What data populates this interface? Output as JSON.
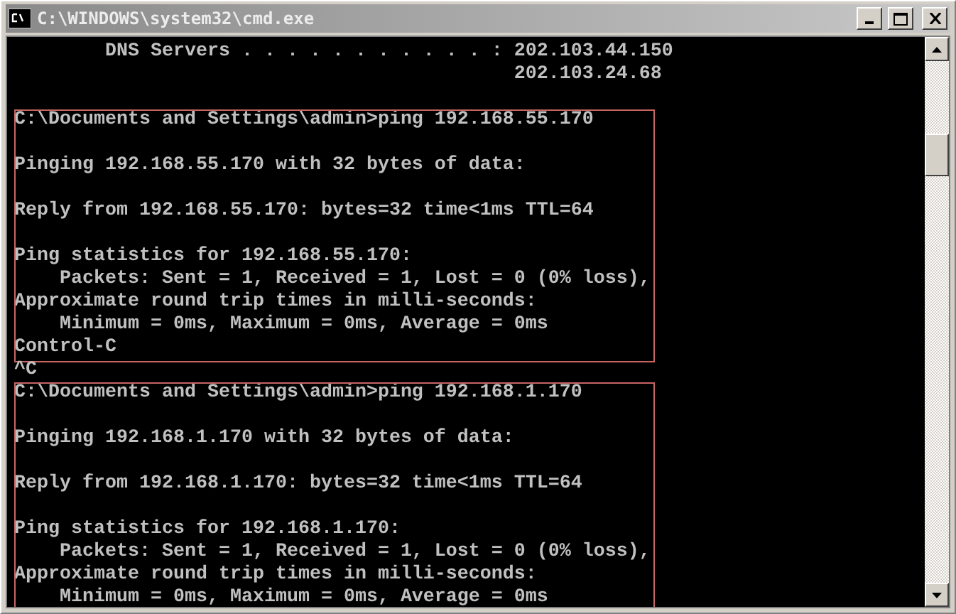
{
  "window": {
    "title": "C:\\WINDOWS\\system32\\cmd.exe"
  },
  "sections": [
    {
      "highlighted": false,
      "lines": [
        {
          "kind": "text",
          "text": "        DNS Servers . . . . . . . . . . . : 202.103.44.150"
        },
        {
          "kind": "text",
          "text": "                                            202.103.24.68"
        },
        {
          "kind": "blank"
        }
      ]
    },
    {
      "highlighted": true,
      "lines": [
        {
          "kind": "text",
          "text": "C:\\Documents and Settings\\admin>ping 192.168.55.170"
        },
        {
          "kind": "blank"
        },
        {
          "kind": "text",
          "text": "Pinging 192.168.55.170 with 32 bytes of data:"
        },
        {
          "kind": "blank"
        },
        {
          "kind": "text",
          "text": "Reply from 192.168.55.170: bytes=32 time<1ms TTL=64"
        },
        {
          "kind": "blank"
        },
        {
          "kind": "text",
          "text": "Ping statistics for 192.168.55.170:"
        },
        {
          "kind": "text",
          "text": "    Packets: Sent = 1, Received = 1, Lost = 0 (0% loss),"
        },
        {
          "kind": "text",
          "text": "Approximate round trip times in milli-seconds:"
        },
        {
          "kind": "text",
          "text": "    Minimum = 0ms, Maximum = 0ms, Average = 0ms"
        },
        {
          "kind": "text",
          "text": "Control-C"
        }
      ]
    },
    {
      "highlighted": false,
      "lines": [
        {
          "kind": "text",
          "text": "^C"
        }
      ]
    },
    {
      "highlighted": true,
      "lines": [
        {
          "kind": "text",
          "text": "C:\\Documents and Settings\\admin>ping 192.168.1.170"
        },
        {
          "kind": "blank"
        },
        {
          "kind": "text",
          "text": "Pinging 192.168.1.170 with 32 bytes of data:"
        },
        {
          "kind": "blank"
        },
        {
          "kind": "text",
          "text": "Reply from 192.168.1.170: bytes=32 time<1ms TTL=64"
        },
        {
          "kind": "blank"
        },
        {
          "kind": "text",
          "text": "Ping statistics for 192.168.1.170:"
        },
        {
          "kind": "text",
          "text": "    Packets: Sent = 1, Received = 1, Lost = 0 (0% loss),"
        },
        {
          "kind": "text",
          "text": "Approximate round trip times in milli-seconds:"
        },
        {
          "kind": "text",
          "text": "    Minimum = 0ms, Maximum = 0ms, Average = 0ms"
        }
      ]
    }
  ]
}
